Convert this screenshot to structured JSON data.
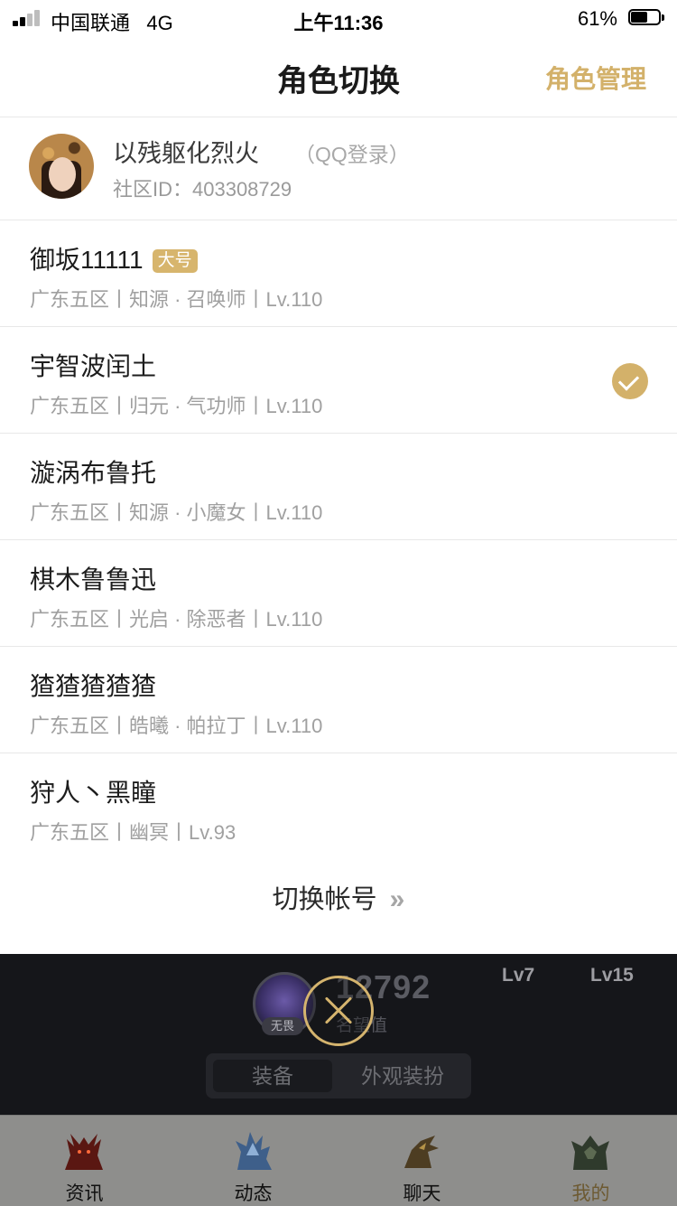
{
  "status_bar": {
    "carrier": "中国联通",
    "network": "4G",
    "time": "上午11:36",
    "battery_percent_label": "61%",
    "battery_level": 0.61
  },
  "nav": {
    "title": "角色切换",
    "manage_label": "角色管理"
  },
  "account": {
    "nickname": "以残躯化烈火",
    "login_type": "（QQ登录）",
    "community_id": "社区ID：403308729"
  },
  "characters": [
    {
      "name": "御坂11111",
      "tag": "大号",
      "detail": "广东五区丨知源 · 召唤师丨Lv.110",
      "selected": false
    },
    {
      "name": "宇智波闰土",
      "tag": "",
      "detail": "广东五区丨归元 · 气功师丨Lv.110",
      "selected": true
    },
    {
      "name": "漩涡布鲁托",
      "tag": "",
      "detail": "广东五区丨知源 · 小魔女丨Lv.110",
      "selected": false
    },
    {
      "name": "棋木鲁鲁迅",
      "tag": "",
      "detail": "广东五区丨光启 · 除恶者丨Lv.110",
      "selected": false
    },
    {
      "name": "猹猹猹猹猹",
      "tag": "",
      "detail": "广东五区丨皓曦 · 帕拉丁丨Lv.110",
      "selected": false
    },
    {
      "name": "狩人丶黑瞳",
      "tag": "",
      "detail": "广东五区丨幽冥丨Lv.93",
      "selected": false
    }
  ],
  "switch_account": {
    "label": "切换帐号",
    "chevron": "»"
  },
  "background_app": {
    "lv_a": "Lv7",
    "lv_b": "Lv15",
    "badge_label": "无畏",
    "score": "12792",
    "score_label": "名望值",
    "tabs": [
      "装备",
      "外观装扮"
    ]
  },
  "tabbar": {
    "items": [
      {
        "label": "资讯",
        "icon": "demon-icon"
      },
      {
        "label": "动态",
        "icon": "crystal-beast-icon"
      },
      {
        "label": "聊天",
        "icon": "dragon-icon"
      },
      {
        "label": "我的",
        "icon": "gargoyle-icon"
      }
    ],
    "active_index": 3
  },
  "colors": {
    "accent_gold": "#d3b16a",
    "overlay_dark": "#15161a",
    "tabbar_gray": "#8e8e8c"
  }
}
